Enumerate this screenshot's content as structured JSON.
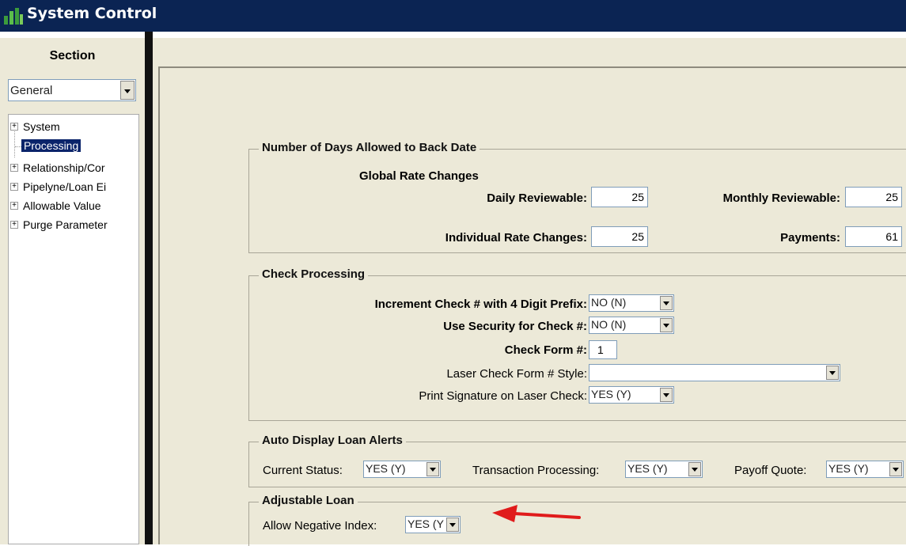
{
  "window": {
    "title": "System Control"
  },
  "section": {
    "label": "Section",
    "selected": "General"
  },
  "tree": {
    "items": [
      {
        "label": "System",
        "expander": "+"
      },
      {
        "label": "Processing",
        "selected": true
      },
      {
        "label": "Relationship/Cor",
        "expander": "+"
      },
      {
        "label": "Pipelyne/Loan Ei",
        "expander": "+"
      },
      {
        "label": "Allowable Value",
        "expander": "+"
      },
      {
        "label": "Purge Parameter",
        "expander": "+"
      }
    ]
  },
  "back_date": {
    "title": "Number of Days Allowed to Back Date",
    "global_rate_label": "Global Rate Changes",
    "daily_reviewable_label": "Daily Reviewable:",
    "daily_reviewable_value": "25",
    "monthly_reviewable_label": "Monthly Reviewable:",
    "monthly_reviewable_value": "25",
    "individual_rate_label": "Individual Rate Changes:",
    "individual_rate_value": "25",
    "payments_label": "Payments:",
    "payments_value": "61"
  },
  "check_processing": {
    "title": "Check Processing",
    "increment_label": "Increment Check # with 4 Digit Prefix:",
    "increment_value": "NO (N)",
    "security_label": "Use Security for Check #:",
    "security_value": "NO (N)",
    "form_label": "Check Form #:",
    "form_value": "1",
    "laser_style_label": "Laser Check Form # Style:",
    "laser_style_value": "",
    "print_signature_label": "Print Signature on Laser Check:",
    "print_signature_value": "YES (Y)"
  },
  "loan_alerts": {
    "title": "Auto Display Loan Alerts",
    "current_status_label": "Current Status:",
    "current_status_value": "YES (Y)",
    "transaction_label": "Transaction Processing:",
    "transaction_value": "YES (Y)",
    "payoff_label": "Payoff Quote:",
    "payoff_value": "YES (Y)"
  },
  "adjustable_loan": {
    "title": "Adjustable Loan",
    "negative_index_label": "Allow Negative Index:",
    "negative_index_value": "YES (Y"
  },
  "colors": {
    "titlebar": "#0b2453",
    "panel": "#ece9d8",
    "selection": "#0a246a",
    "arrow": "#e01b1b"
  }
}
